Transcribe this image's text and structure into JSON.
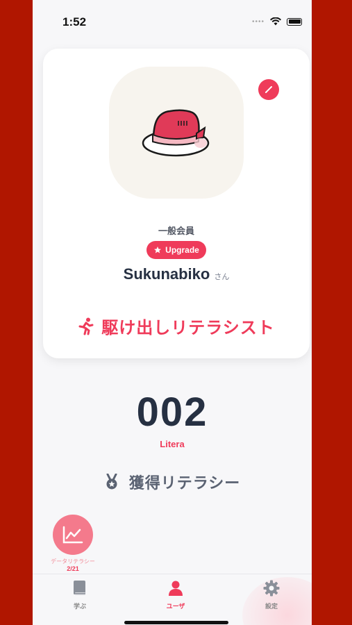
{
  "status_bar": {
    "time": "1:52"
  },
  "profile": {
    "membership": "一般会員",
    "upgrade_label": "Upgrade",
    "username": "Sukunabiko",
    "honorific": "さん",
    "rank": "駆け出しリテラシスト"
  },
  "stats": {
    "litera_count": "002",
    "litera_unit": "Litera",
    "acquired_label": "獲得リテラシー"
  },
  "fab": {
    "label": "データリテラシー",
    "count": "2/21"
  },
  "tabs": [
    {
      "label": "学ぶ",
      "icon": "book-icon"
    },
    {
      "label": "ユーザ",
      "icon": "user-icon"
    },
    {
      "label": "設定",
      "icon": "gear-icon"
    }
  ],
  "colors": {
    "accent": "#ef3b5a",
    "frame": "#b01600",
    "text_dark": "#263042"
  }
}
